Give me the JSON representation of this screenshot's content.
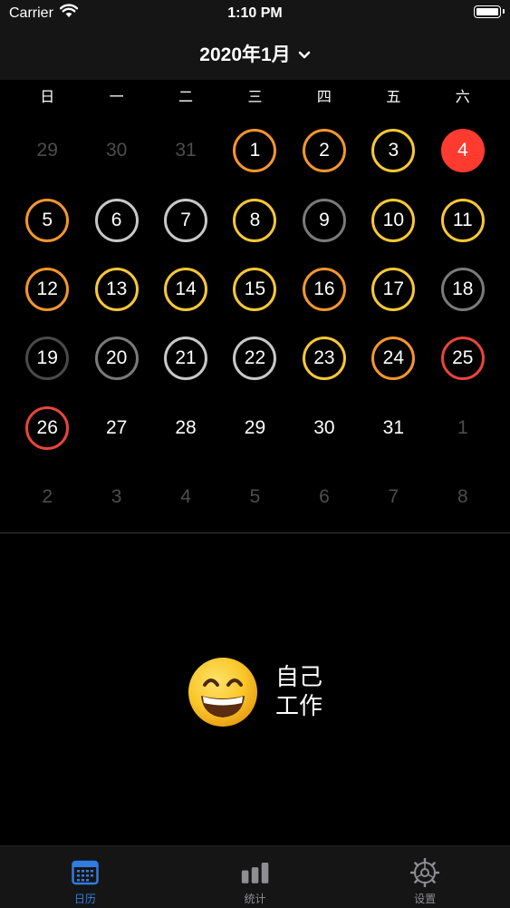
{
  "status_bar": {
    "carrier": "Carrier",
    "time": "1:10 PM"
  },
  "header": {
    "month_title": "2020年1月"
  },
  "weekdays": [
    "日",
    "一",
    "二",
    "三",
    "四",
    "五",
    "六"
  ],
  "days": [
    {
      "label": "29",
      "style": "dim"
    },
    {
      "label": "30",
      "style": "dim"
    },
    {
      "label": "31",
      "style": "dim"
    },
    {
      "label": "1",
      "style": "orange"
    },
    {
      "label": "2",
      "style": "orange"
    },
    {
      "label": "3",
      "style": "yellow"
    },
    {
      "label": "4",
      "style": "today"
    },
    {
      "label": "5",
      "style": "orange"
    },
    {
      "label": "6",
      "style": "lgray"
    },
    {
      "label": "7",
      "style": "lgray"
    },
    {
      "label": "8",
      "style": "yellow"
    },
    {
      "label": "9",
      "style": "dgray"
    },
    {
      "label": "10",
      "style": "yellow"
    },
    {
      "label": "11",
      "style": "yellow"
    },
    {
      "label": "12",
      "style": "orange"
    },
    {
      "label": "13",
      "style": "yellow"
    },
    {
      "label": "14",
      "style": "yellow"
    },
    {
      "label": "15",
      "style": "yellow"
    },
    {
      "label": "16",
      "style": "orange"
    },
    {
      "label": "17",
      "style": "yellow"
    },
    {
      "label": "18",
      "style": "dgray"
    },
    {
      "label": "19",
      "style": "xgray"
    },
    {
      "label": "20",
      "style": "dgray"
    },
    {
      "label": "21",
      "style": "lgray"
    },
    {
      "label": "22",
      "style": "lgray"
    },
    {
      "label": "23",
      "style": "yellow"
    },
    {
      "label": "24",
      "style": "orange"
    },
    {
      "label": "25",
      "style": "red"
    },
    {
      "label": "26",
      "style": "red"
    },
    {
      "label": "27",
      "style": "plain"
    },
    {
      "label": "28",
      "style": "plain"
    },
    {
      "label": "29",
      "style": "plain"
    },
    {
      "label": "30",
      "style": "plain"
    },
    {
      "label": "31",
      "style": "plain"
    },
    {
      "label": "1",
      "style": "dim"
    },
    {
      "label": "2",
      "style": "dim"
    },
    {
      "label": "3",
      "style": "dim"
    },
    {
      "label": "4",
      "style": "dim"
    },
    {
      "label": "5",
      "style": "dim"
    },
    {
      "label": "6",
      "style": "dim"
    },
    {
      "label": "7",
      "style": "dim"
    },
    {
      "label": "8",
      "style": "dim"
    }
  ],
  "colors": {
    "orange": "#F4962D",
    "yellow": "#F8C835",
    "light_gray": "#C8C8C8",
    "dark_gray": "#7A7A7A",
    "red": "#E8453C",
    "today": "#FF3B30",
    "tab_active": "#2F7DE1"
  },
  "selected_entry": {
    "emoji": "grinning-face-smiling-eyes",
    "line1": "自己",
    "line2": "工作"
  },
  "tabs": [
    {
      "label": "日历",
      "icon": "calendar-icon",
      "active": true
    },
    {
      "label": "统计",
      "icon": "bar-chart-icon",
      "active": false
    },
    {
      "label": "设置",
      "icon": "gear-icon",
      "active": false
    }
  ]
}
